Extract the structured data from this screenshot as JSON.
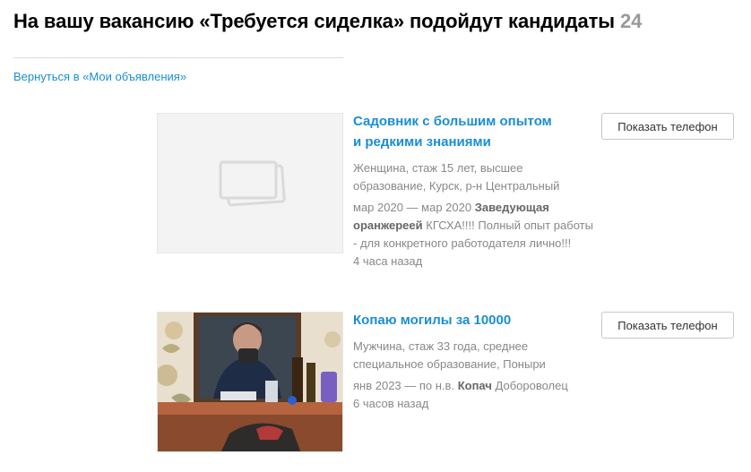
{
  "header": {
    "title": "На вашу вакансию «Требуется сиделка» подойдут кандидаты",
    "count": "24"
  },
  "back_link": "Вернуться в «Мои объявления»",
  "candidates": [
    {
      "title_line1": "Садовник с большим опытом",
      "title_line2": "и редкими знаниями",
      "summary": "Женщина, стаж 15 лет, высшее образование, Курск, р-н Центральный",
      "exp_period": "мар 2020 — мар 2020",
      "exp_position": "Заведующая оранжереей",
      "exp_text": "КГСХА!!!! Полный опыт работы - для конкретного работодателя лично!!!",
      "time": "4 часа назад",
      "button": "Показать телефон",
      "thumb_icon": "image-placeholder-icon"
    },
    {
      "title_line1": "Копаю могилы за 10000",
      "summary": "Мужчина, стаж 33 года, среднее специальное образование, Поныри",
      "exp_period": "янв 2023 — по н.в.",
      "exp_position": "Копач",
      "exp_text": "Добороволец",
      "time": "6 часов назад",
      "button": "Показать телефон",
      "thumb_icon": "candidate-photo"
    }
  ],
  "colors": {
    "link": "#1a8ed4",
    "muted": "#888888",
    "count": "#999999"
  }
}
